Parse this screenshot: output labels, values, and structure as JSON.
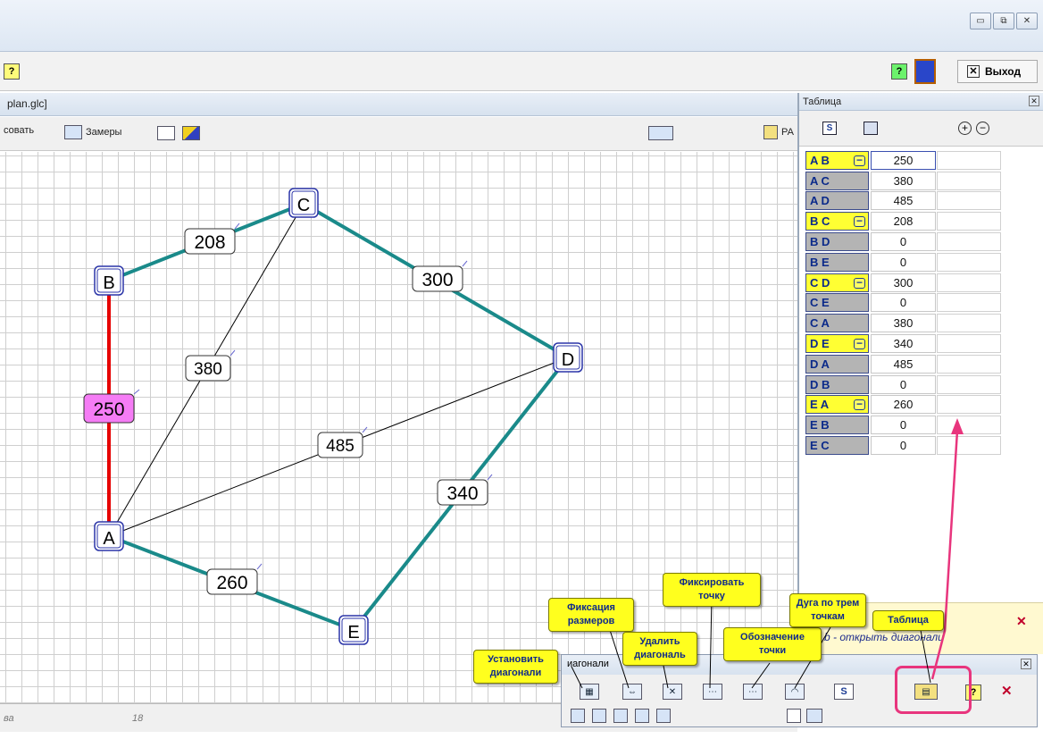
{
  "window": {
    "minimize": "▭",
    "restore": "⧉",
    "close": "✕"
  },
  "toolbar1": {
    "help_glyph": "?",
    "exit_label": "Выход",
    "exit_glyph": "✕"
  },
  "child": {
    "title": "plan.glc]",
    "draw_label": "совать",
    "measures_label": "Замеры",
    "ra_label": "РА"
  },
  "canvas": {
    "points": [
      {
        "label": "A"
      },
      {
        "label": "B"
      },
      {
        "label": "C"
      },
      {
        "label": "D"
      },
      {
        "label": "E"
      }
    ],
    "edges": [
      {
        "from": "A",
        "to": "B",
        "value": "250",
        "style": "selected"
      },
      {
        "from": "B",
        "to": "C",
        "value": "208",
        "style": "fixed"
      },
      {
        "from": "C",
        "to": "D",
        "value": "300",
        "style": "fixed"
      },
      {
        "from": "D",
        "to": "E",
        "value": "340",
        "style": "fixed"
      },
      {
        "from": "E",
        "to": "A",
        "value": "260",
        "style": "fixed"
      },
      {
        "from": "A",
        "to": "C",
        "value": "380",
        "style": "diagonal"
      },
      {
        "from": "A",
        "to": "D",
        "value": "485",
        "style": "diagonal"
      }
    ],
    "colors": {
      "fixed": "#1a8a8a",
      "selected": "#e60000",
      "diagonal": "#000000",
      "selected_label_bg": "#f57cf5"
    }
  },
  "status": {
    "left": "ва",
    "number": "18"
  },
  "table_panel": {
    "title": "Таблица",
    "rows": [
      {
        "name": "A B",
        "value": "250",
        "fixed": true,
        "active": true
      },
      {
        "name": "A C",
        "value": "380",
        "fixed": false
      },
      {
        "name": "A D",
        "value": "485",
        "fixed": false
      },
      {
        "name": "B C",
        "value": "208",
        "fixed": true
      },
      {
        "name": "B D",
        "value": "0",
        "fixed": false
      },
      {
        "name": "B E",
        "value": "0",
        "fixed": false
      },
      {
        "name": "C D",
        "value": "300",
        "fixed": true
      },
      {
        "name": "C E",
        "value": "0",
        "fixed": false
      },
      {
        "name": "C A",
        "value": "380",
        "fixed": false
      },
      {
        "name": "D E",
        "value": "340",
        "fixed": true
      },
      {
        "name": "D A",
        "value": "485",
        "fixed": false
      },
      {
        "name": "D B",
        "value": "0",
        "fixed": false
      },
      {
        "name": "E A",
        "value": "260",
        "fixed": true
      },
      {
        "name": "E B",
        "value": "0",
        "fixed": false
      },
      {
        "name": "E C",
        "value": "0",
        "fixed": false
      }
    ]
  },
  "hint": {
    "text": "b -   открыть диагонали",
    "close": "✕"
  },
  "diag_window": {
    "title": "иагонали"
  },
  "tips": {
    "set_diag": "Установить диагонали",
    "fix_sizes": "Фиксация размеров",
    "delete_diag": "Удалить диагональ",
    "fix_point": "Фиксировать точку",
    "point_label": "Обозначение точки",
    "arc": "Дуга по трем точкам",
    "table": "Таблица"
  },
  "accent": {
    "pink": "#e8357d",
    "tip_yellow": "#ffff1e"
  }
}
